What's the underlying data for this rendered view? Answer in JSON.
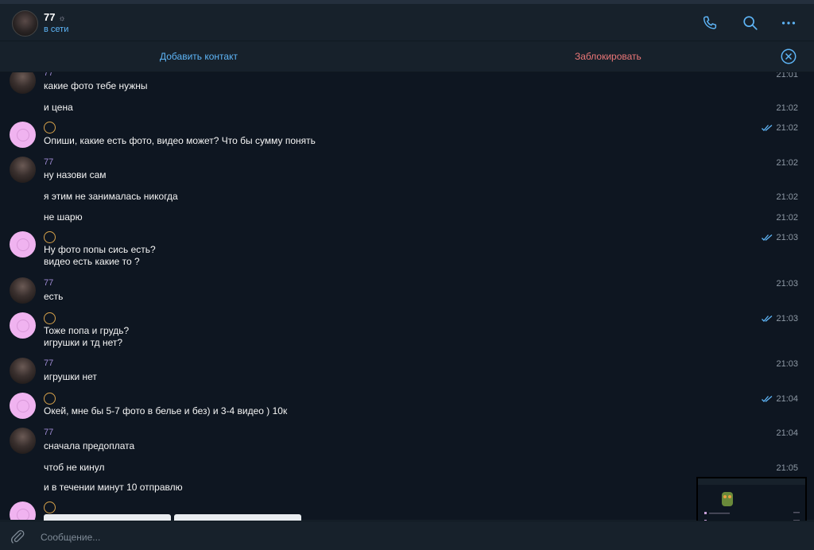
{
  "header": {
    "contact_name": "77",
    "name_decoration": "☼",
    "status": "в сети",
    "icons": [
      "phone-icon",
      "search-icon",
      "more-icon"
    ]
  },
  "action_bar": {
    "add_contact": "Добавить контакт",
    "block": "Заблокировать"
  },
  "messages": [
    {
      "sender": "77",
      "text": "какие фото тебе нужны",
      "time": "21:01"
    },
    {
      "sender": "",
      "text": "и цена",
      "time": "21:02"
    },
    {
      "sender": "me",
      "text": "Опиши, какие есть фото, видео может? Что бы сумму понять",
      "time": "21:02",
      "read": true
    },
    {
      "sender": "77",
      "text": "ну назови сам",
      "time": "21:02"
    },
    {
      "sender": "",
      "text": "я этим не занималась никогда",
      "time": "21:02"
    },
    {
      "sender": "",
      "text": "не шарю",
      "time": "21:02"
    },
    {
      "sender": "me",
      "text": "Ну фото попы сись есть?",
      "text2": "видео есть какие то ?",
      "time": "21:03",
      "read": true
    },
    {
      "sender": "77",
      "text": "есть",
      "time": "21:03"
    },
    {
      "sender": "me",
      "text": "Тоже попа и грудь?",
      "text2": "игрушки и тд нет?",
      "time": "21:03",
      "read": true
    },
    {
      "sender": "77",
      "text": "игрушки нет",
      "time": "21:03"
    },
    {
      "sender": "me",
      "text": "Окей, мне бы 5-7 фото в белье и без) и 3-4 видео ) 10к",
      "time": "21:04",
      "read": true
    },
    {
      "sender": "77",
      "text": "сначала предоплата",
      "time": "21:04"
    },
    {
      "sender": "",
      "text": "чтоб не кинул",
      "time": "21:05"
    },
    {
      "sender": "",
      "text": "и в течении минут 10 отправлю",
      "time": ""
    }
  ],
  "composer": {
    "placeholder": "Сообщение..."
  },
  "colors": {
    "accent": "#5eb5f7",
    "danger": "#ec7778",
    "sender_name": "#9f8bd4",
    "background": "#0e1621",
    "panel": "#17212b"
  }
}
